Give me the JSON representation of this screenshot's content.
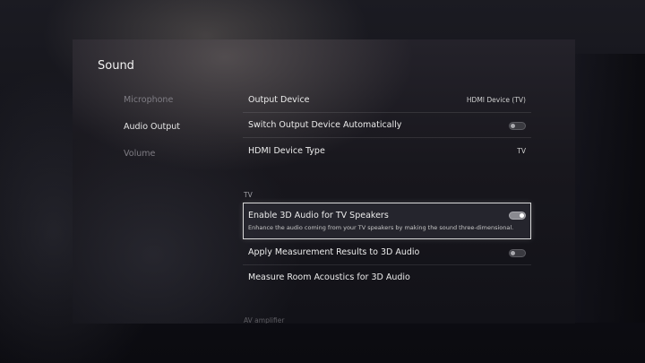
{
  "page": {
    "title": "Sound"
  },
  "nav": {
    "items": [
      {
        "label": "Microphone",
        "active": false
      },
      {
        "label": "Audio Output",
        "active": true
      },
      {
        "label": "Volume",
        "active": false
      }
    ]
  },
  "settings": {
    "output_device": {
      "label": "Output Device",
      "value": "HDMI Device (TV)"
    },
    "switch_output": {
      "label": "Switch Output Device Automatically",
      "toggle": "off"
    },
    "hdmi_type": {
      "label": "HDMI Device Type",
      "value": "TV"
    },
    "section_tv": "TV",
    "enable_3d": {
      "label": "Enable 3D Audio for TV Speakers",
      "description": "Enhance the audio coming from your TV speakers by making the sound three-dimensional.",
      "toggle": "on"
    },
    "apply_measurement": {
      "label": "Apply Measurement Results to 3D Audio",
      "toggle": "off"
    },
    "measure_room": {
      "label": "Measure Room Acoustics for 3D Audio"
    },
    "section_av": "AV amplifier"
  },
  "colors": {
    "focus_border": "#d8d8d8",
    "toggle_on": "#8a8a90",
    "toggle_off": "#3a3a40"
  }
}
